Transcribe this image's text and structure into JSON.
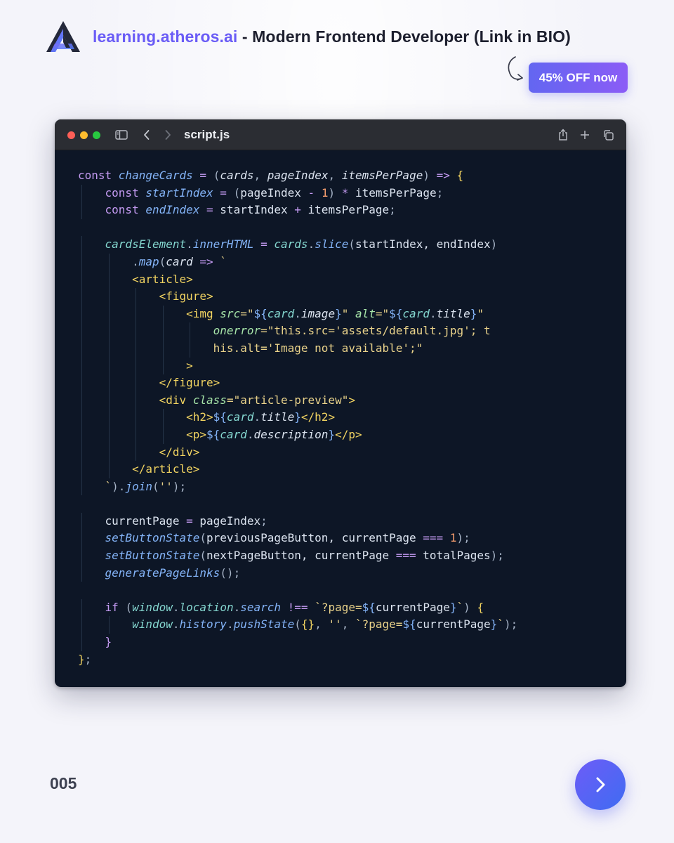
{
  "header": {
    "site": "learning.atheros.ai",
    "tagline": " - Modern Frontend Developer (Link in BIO)",
    "logo_icon": "atheros-logo-icon"
  },
  "promo": {
    "label": "45% OFF now",
    "arrow_icon": "curved-arrow-icon"
  },
  "window": {
    "title": "script.js",
    "icons": [
      "sidebar-icon",
      "back-icon",
      "forward-icon",
      "share-icon",
      "new-tab-icon",
      "tabs-overview-icon"
    ]
  },
  "code": [
    [
      [
        "kw",
        "const "
      ],
      [
        "fn",
        "changeCards"
      ],
      [
        "plain",
        " "
      ],
      [
        "op",
        "="
      ],
      [
        "plain",
        " "
      ],
      [
        "punc",
        "("
      ],
      [
        "var",
        "cards"
      ],
      [
        "punc",
        ", "
      ],
      [
        "var",
        "pageIndex"
      ],
      [
        "punc",
        ", "
      ],
      [
        "var",
        "itemsPerPage"
      ],
      [
        "punc",
        ")"
      ],
      [
        "plain",
        " "
      ],
      [
        "op",
        "=>"
      ],
      [
        "plain",
        " "
      ],
      [
        "brace",
        "{"
      ]
    ],
    [
      [
        "plain",
        "    "
      ],
      [
        "kw",
        "const "
      ],
      [
        "fn",
        "startIndex"
      ],
      [
        "plain",
        " "
      ],
      [
        "op",
        "="
      ],
      [
        "plain",
        " "
      ],
      [
        "punc",
        "("
      ],
      [
        "plain",
        "pageIndex "
      ],
      [
        "op",
        "-"
      ],
      [
        "plain",
        " "
      ],
      [
        "num",
        "1"
      ],
      [
        "punc",
        ")"
      ],
      [
        "plain",
        " "
      ],
      [
        "op",
        "*"
      ],
      [
        "plain",
        " itemsPerPage"
      ],
      [
        "punc",
        ";"
      ]
    ],
    [
      [
        "plain",
        "    "
      ],
      [
        "kw",
        "const "
      ],
      [
        "fn",
        "endIndex"
      ],
      [
        "plain",
        " "
      ],
      [
        "op",
        "="
      ],
      [
        "plain",
        " startIndex "
      ],
      [
        "op",
        "+"
      ],
      [
        "plain",
        " itemsPerPage"
      ],
      [
        "punc",
        ";"
      ]
    ],
    [],
    [
      [
        "plain",
        "    "
      ],
      [
        "prop",
        "cardsElement"
      ],
      [
        "punc",
        "."
      ],
      [
        "fn",
        "innerHTML"
      ],
      [
        "plain",
        " "
      ],
      [
        "op",
        "="
      ],
      [
        "plain",
        " "
      ],
      [
        "prop",
        "cards"
      ],
      [
        "punc",
        "."
      ],
      [
        "fn",
        "slice"
      ],
      [
        "punc",
        "("
      ],
      [
        "plain",
        "startIndex, endIndex"
      ],
      [
        "punc",
        ")"
      ]
    ],
    [
      [
        "plain",
        "        "
      ],
      [
        "punc",
        "."
      ],
      [
        "fn",
        "map"
      ],
      [
        "punc",
        "("
      ],
      [
        "var",
        "card"
      ],
      [
        "plain",
        " "
      ],
      [
        "op",
        "=>"
      ],
      [
        "plain",
        " "
      ],
      [
        "str",
        "`"
      ]
    ],
    [
      [
        "plain",
        "        "
      ],
      [
        "tag",
        "<article>"
      ]
    ],
    [
      [
        "plain",
        "            "
      ],
      [
        "tag",
        "<figure>"
      ]
    ],
    [
      [
        "plain",
        "                "
      ],
      [
        "tag",
        "<img "
      ],
      [
        "attr",
        "src"
      ],
      [
        "str",
        "=\""
      ],
      [
        "interp",
        "${"
      ],
      [
        "prop",
        "card"
      ],
      [
        "punc",
        "."
      ],
      [
        "var",
        "image"
      ],
      [
        "interp",
        "}"
      ],
      [
        "str",
        "\" "
      ],
      [
        "attr",
        "alt"
      ],
      [
        "str",
        "=\""
      ],
      [
        "interp",
        "${"
      ],
      [
        "prop",
        "card"
      ],
      [
        "punc",
        "."
      ],
      [
        "var",
        "title"
      ],
      [
        "interp",
        "}"
      ],
      [
        "str",
        "\""
      ]
    ],
    [
      [
        "plain",
        "                    "
      ],
      [
        "attr",
        "onerror"
      ],
      [
        "str",
        "=\"this.src='assets/default.jpg'; t"
      ]
    ],
    [
      [
        "plain",
        "                    "
      ],
      [
        "str",
        "his.alt='Image not available';\""
      ]
    ],
    [
      [
        "plain",
        "                "
      ],
      [
        "tag",
        ">"
      ]
    ],
    [
      [
        "plain",
        "            "
      ],
      [
        "tag",
        "</figure>"
      ]
    ],
    [
      [
        "plain",
        "            "
      ],
      [
        "tag",
        "<div "
      ],
      [
        "attr",
        "class"
      ],
      [
        "str",
        "=\"article-preview\""
      ],
      [
        "tag",
        ">"
      ]
    ],
    [
      [
        "plain",
        "                "
      ],
      [
        "tag",
        "<h2>"
      ],
      [
        "interp",
        "${"
      ],
      [
        "prop",
        "card"
      ],
      [
        "punc",
        "."
      ],
      [
        "var",
        "title"
      ],
      [
        "interp",
        "}"
      ],
      [
        "tag",
        "</h2>"
      ]
    ],
    [
      [
        "plain",
        "                "
      ],
      [
        "tag",
        "<p>"
      ],
      [
        "interp",
        "${"
      ],
      [
        "prop",
        "card"
      ],
      [
        "punc",
        "."
      ],
      [
        "var",
        "description"
      ],
      [
        "interp",
        "}"
      ],
      [
        "tag",
        "</p>"
      ]
    ],
    [
      [
        "plain",
        "            "
      ],
      [
        "tag",
        "</div>"
      ]
    ],
    [
      [
        "plain",
        "        "
      ],
      [
        "tag",
        "</article>"
      ]
    ],
    [
      [
        "plain",
        "    "
      ],
      [
        "str",
        "`"
      ],
      [
        "punc",
        ")."
      ],
      [
        "fn",
        "join"
      ],
      [
        "punc",
        "("
      ],
      [
        "str",
        "''"
      ],
      [
        "punc",
        ");"
      ]
    ],
    [],
    [
      [
        "plain",
        "    currentPage "
      ],
      [
        "op",
        "="
      ],
      [
        "plain",
        " pageIndex"
      ],
      [
        "punc",
        ";"
      ]
    ],
    [
      [
        "plain",
        "    "
      ],
      [
        "fn",
        "setButtonState"
      ],
      [
        "punc",
        "("
      ],
      [
        "plain",
        "previousPageButton, currentPage "
      ],
      [
        "op",
        "==="
      ],
      [
        "plain",
        " "
      ],
      [
        "num",
        "1"
      ],
      [
        "punc",
        ");"
      ]
    ],
    [
      [
        "plain",
        "    "
      ],
      [
        "fn",
        "setButtonState"
      ],
      [
        "punc",
        "("
      ],
      [
        "plain",
        "nextPageButton, currentPage "
      ],
      [
        "op",
        "==="
      ],
      [
        "plain",
        " totalPages"
      ],
      [
        "punc",
        ");"
      ]
    ],
    [
      [
        "plain",
        "    "
      ],
      [
        "fn",
        "generatePageLinks"
      ],
      [
        "punc",
        "();"
      ]
    ],
    [],
    [
      [
        "plain",
        "    "
      ],
      [
        "kw",
        "if "
      ],
      [
        "punc",
        "("
      ],
      [
        "prop",
        "window"
      ],
      [
        "punc",
        "."
      ],
      [
        "prop",
        "location"
      ],
      [
        "punc",
        "."
      ],
      [
        "fn",
        "search"
      ],
      [
        "plain",
        " "
      ],
      [
        "op",
        "!=="
      ],
      [
        "plain",
        " "
      ],
      [
        "str",
        "`?page="
      ],
      [
        "interp",
        "${"
      ],
      [
        "plain",
        "currentPage"
      ],
      [
        "interp",
        "}"
      ],
      [
        "str",
        "`"
      ],
      [
        "punc",
        ")"
      ],
      [
        "plain",
        " "
      ],
      [
        "brace",
        "{"
      ]
    ],
    [
      [
        "plain",
        "        "
      ],
      [
        "prop",
        "window"
      ],
      [
        "punc",
        "."
      ],
      [
        "fn",
        "history"
      ],
      [
        "punc",
        "."
      ],
      [
        "fn",
        "pushState"
      ],
      [
        "punc",
        "("
      ],
      [
        "brace",
        "{}"
      ],
      [
        "punc",
        ", "
      ],
      [
        "str",
        "''"
      ],
      [
        "punc",
        ", "
      ],
      [
        "str",
        "`?page="
      ],
      [
        "interp",
        "${"
      ],
      [
        "plain",
        "currentPage"
      ],
      [
        "interp",
        "}"
      ],
      [
        "str",
        "`"
      ],
      [
        "punc",
        ");"
      ]
    ],
    [
      [
        "plain",
        "    "
      ],
      [
        "op",
        "}"
      ]
    ],
    [
      [
        "brace",
        "}"
      ],
      [
        "punc",
        ";"
      ]
    ]
  ],
  "footer": {
    "page_number": "005",
    "next_icon": "chevron-right-icon"
  }
}
